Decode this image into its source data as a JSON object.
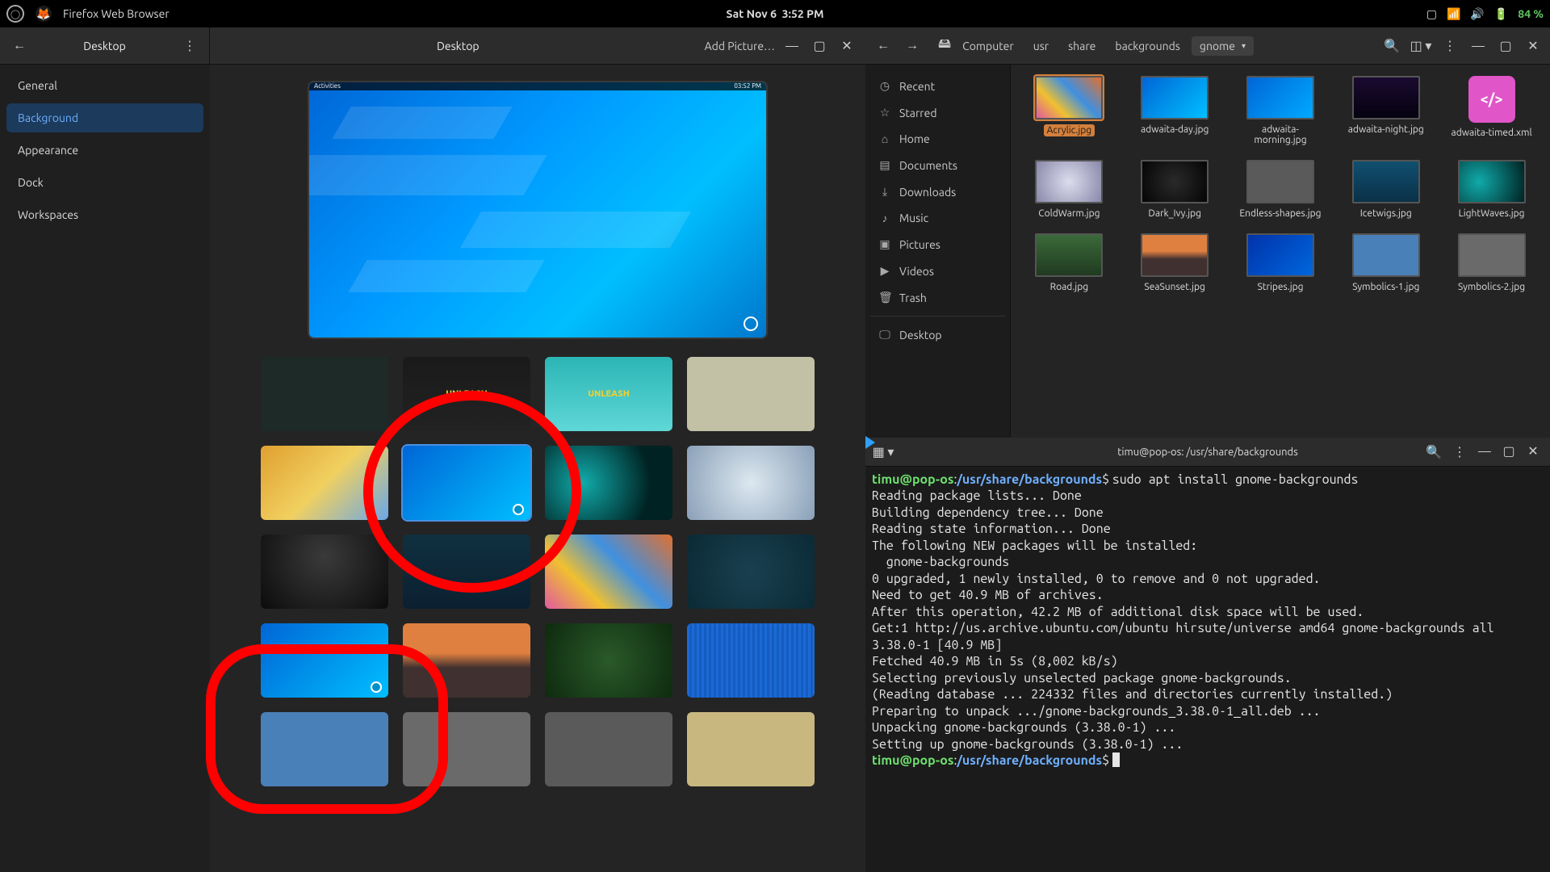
{
  "topbar": {
    "app": "Firefox Web Browser",
    "date": "Sat Nov 6",
    "time": "3:52 PM",
    "battery": "84 %"
  },
  "settings": {
    "header_sidebar_title": "Desktop",
    "header_main_title": "Desktop",
    "add_picture_label": "Add Picture…",
    "nav": {
      "general": "General",
      "background": "Background",
      "appearance": "Appearance",
      "dock": "Dock",
      "workspaces": "Workspaces"
    },
    "preview": {
      "activities": "Activities",
      "clock": "03:52 PM"
    },
    "thumbs": [
      {
        "name": "pattern-dark-hex",
        "bg": "#1e2a28"
      },
      {
        "name": "unleash-dark",
        "bg": "linear-gradient(#1a1a1a,#222)",
        "text": "UNLEASH"
      },
      {
        "name": "unleash-teal",
        "bg": "linear-gradient(#2bb5b5,#5fd7d7)",
        "text": "UNLEASH"
      },
      {
        "name": "robot-city",
        "bg": "#c2c0a5"
      },
      {
        "name": "warm-poly",
        "bg": "linear-gradient(135deg,#e0a030,#f0d060 50%,#6aa8e8)"
      },
      {
        "name": "adwaita-day-blue",
        "bg": "linear-gradient(135deg,#0066d6,#00bfff)",
        "timed": true,
        "selected": true
      },
      {
        "name": "lightwaves",
        "bg": "radial-gradient(circle at 30% 50%, #1aa 0%, #022 70%)"
      },
      {
        "name": "cold-warm-ice",
        "bg": "radial-gradient(circle, #dde8f0, #8aa0b8)"
      },
      {
        "name": "dark-ivy",
        "bg": "radial-gradient(circle at 50% 30%, #3a3a3a, #0c0c0c)"
      },
      {
        "name": "icetwigs",
        "bg": "linear-gradient(#103040,#0b2030)"
      },
      {
        "name": "acrylic",
        "bg": "linear-gradient(45deg,#e05aa0,#f0c030 30%,#4090e0 60%,#e07030)"
      },
      {
        "name": "road-aerial",
        "bg": "radial-gradient(circle,#1a4050,#0a2a35)"
      },
      {
        "name": "adwaita-morning-blue",
        "bg": "linear-gradient(135deg,#0066d6,#00bfff)",
        "timed": true
      },
      {
        "name": "sea-sunset",
        "bg": "linear-gradient(#e08040 40%,#403030 60%)"
      },
      {
        "name": "green-ferns",
        "bg": "radial-gradient(circle,#2a5a2a,#0e2a0e)"
      },
      {
        "name": "stripes-blue",
        "bg": "repeating-linear-gradient(90deg,#1a6ad6 0 3px,#155cc0 3px 6px)"
      },
      {
        "name": "symbolics-1",
        "bg": "#4a80b8"
      },
      {
        "name": "symbolics-2",
        "bg": "#6a6a6a"
      },
      {
        "name": "endless-shapes",
        "bg": "#5a5a5a"
      },
      {
        "name": "tan-paper",
        "bg": "#c8b880"
      }
    ]
  },
  "files": {
    "path": {
      "root": "Computer",
      "p1": "usr",
      "p2": "share",
      "p3": "backgrounds",
      "current": "gnome"
    },
    "side": {
      "recent": "Recent",
      "starred": "Starred",
      "home": "Home",
      "documents": "Documents",
      "downloads": "Downloads",
      "music": "Music",
      "pictures": "Pictures",
      "videos": "Videos",
      "trash": "Trash",
      "desktop": "Desktop"
    },
    "items": [
      {
        "name": "Acrylic.jpg",
        "bg": "linear-gradient(45deg,#e05aa0,#f0c030 30%,#4090e0 60%,#e07030)",
        "selected": true
      },
      {
        "name": "adwaita-day.jpg",
        "bg": "linear-gradient(135deg,#0066d6,#00bfff)"
      },
      {
        "name": "adwaita-morning.jpg",
        "bg": "linear-gradient(135deg,#0066d6,#00aaff)"
      },
      {
        "name": "adwaita-night.jpg",
        "bg": "linear-gradient(#1a0a30,#05020f)"
      },
      {
        "name": "adwaita-timed.xml",
        "xml": true
      },
      {
        "name": "ColdWarm.jpg",
        "bg": "radial-gradient(circle,#dde,#88a)"
      },
      {
        "name": "Dark_Ivy.jpg",
        "bg": "radial-gradient(circle,#2a2a2a,#050505)"
      },
      {
        "name": "Endless-shapes.jpg",
        "bg": "#5a5a5a"
      },
      {
        "name": "Icetwigs.jpg",
        "bg": "linear-gradient(#105070,#0a3048)"
      },
      {
        "name": "LightWaves.jpg",
        "bg": "radial-gradient(circle at 30% 50%, #1aa, #022)"
      },
      {
        "name": "Road.jpg",
        "bg": "linear-gradient(#3a6a3a,#203a20)"
      },
      {
        "name": "SeaSunset.jpg",
        "bg": "linear-gradient(#e08040 40%,#403030 60%)"
      },
      {
        "name": "Stripes.jpg",
        "bg": "linear-gradient(135deg,#0033aa,#0066dd)"
      },
      {
        "name": "Symbolics-1.jpg",
        "bg": "#4a80b8"
      },
      {
        "name": "Symbolics-2.jpg",
        "bg": "#6a6a6a"
      }
    ]
  },
  "terminal": {
    "title": "timu@pop-os: /usr/share/backgrounds",
    "prompt_user": "timu@pop-os",
    "prompt_path": "/usr/share/backgrounds",
    "cmd": "sudo apt install gnome-backgrounds",
    "out": "Reading package lists... Done\nBuilding dependency tree... Done\nReading state information... Done\nThe following NEW packages will be installed:\n  gnome-backgrounds\n0 upgraded, 1 newly installed, 0 to remove and 0 not upgraded.\nNeed to get 40.9 MB of archives.\nAfter this operation, 42.2 MB of additional disk space will be used.\nGet:1 http://us.archive.ubuntu.com/ubuntu hirsute/universe amd64 gnome-backgrounds all 3.38.0-1 [40.9 MB]\nFetched 40.9 MB in 5s (8,002 kB/s)\nSelecting previously unselected package gnome-backgrounds.\n(Reading database ... 224332 files and directories currently installed.)\nPreparing to unpack .../gnome-backgrounds_3.38.0-1_all.deb ...\nUnpacking gnome-backgrounds (3.38.0-1) ...\nSetting up gnome-backgrounds (3.38.0-1) ..."
  }
}
